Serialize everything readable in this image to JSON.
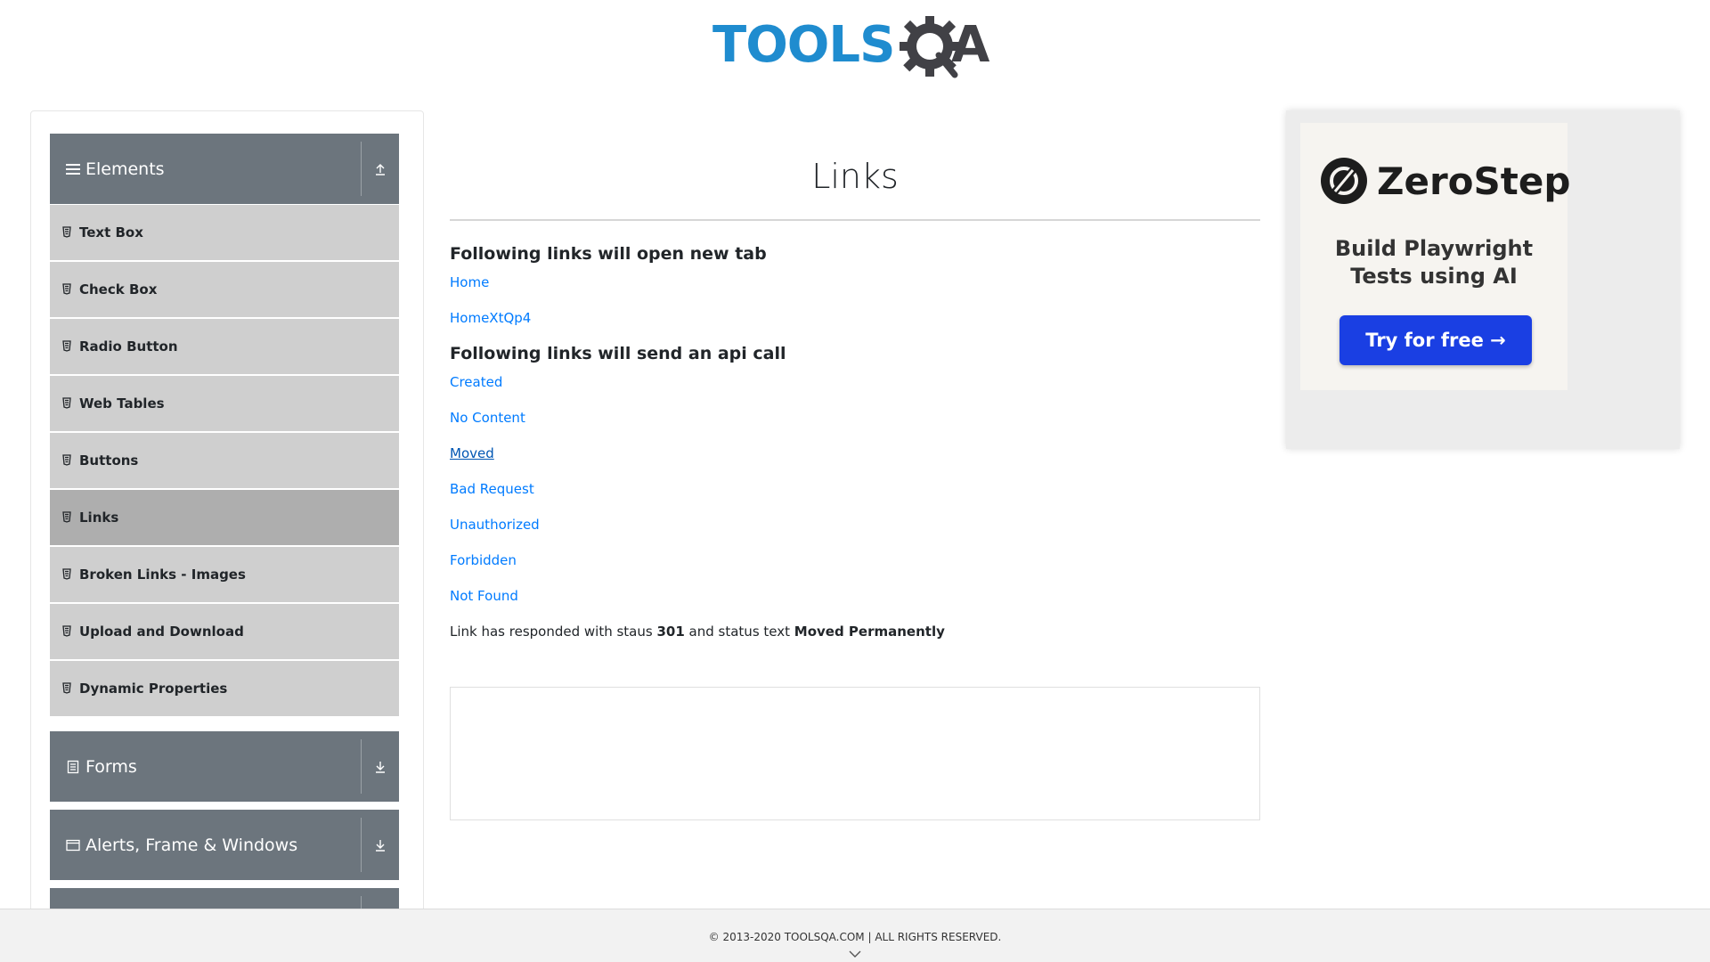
{
  "logo": {
    "text": "TOOLS",
    "text_suffix": "A"
  },
  "sidebar": {
    "groups": [
      {
        "label": "Elements",
        "icon": "hamburger-icon",
        "toggle_icon": "collapse-arrow-icon",
        "expanded": true
      },
      {
        "label": "Forms",
        "icon": "form-icon",
        "toggle_icon": "expand-arrow-icon",
        "expanded": false
      },
      {
        "label": "Alerts, Frame & Windows",
        "icon": "window-icon",
        "toggle_icon": "expand-arrow-icon",
        "expanded": false
      }
    ],
    "items": [
      {
        "label": "Text Box",
        "active": false
      },
      {
        "label": "Check Box",
        "active": false
      },
      {
        "label": "Radio Button",
        "active": false
      },
      {
        "label": "Web Tables",
        "active": false
      },
      {
        "label": "Buttons",
        "active": false
      },
      {
        "label": "Links",
        "active": true
      },
      {
        "label": "Broken Links - Images",
        "active": false
      },
      {
        "label": "Upload and Download",
        "active": false
      },
      {
        "label": "Dynamic Properties",
        "active": false
      }
    ]
  },
  "main": {
    "title": "Links",
    "new_tab_heading": "Following links will open new tab",
    "new_tab_links": [
      "Home",
      "HomeXtQp4"
    ],
    "api_heading": "Following links will send an api call",
    "api_links": [
      "Created",
      "No Content",
      "Moved",
      "Bad Request",
      "Unauthorized",
      "Forbidden",
      "Not Found"
    ],
    "response": {
      "prefix": "Link has responded with staus ",
      "status_code": "301",
      "middle": " and status text ",
      "status_text": "Moved Permanently"
    }
  },
  "ad": {
    "brand": "ZeroStep",
    "tagline_line1": "Build Playwright",
    "tagline_line2": "Tests using AI",
    "cta": "Try for free →",
    "cta_color": "#1a3fe3"
  },
  "footer": {
    "text": "© 2013-2020 TOOLSQA.COM | ALL RIGHTS RESERVED."
  },
  "colors": {
    "accent_link": "#007bff",
    "sidebar_header": "#6c757d",
    "menu_item": "#cfcfcf",
    "menu_item_active": "#aeaeae"
  }
}
